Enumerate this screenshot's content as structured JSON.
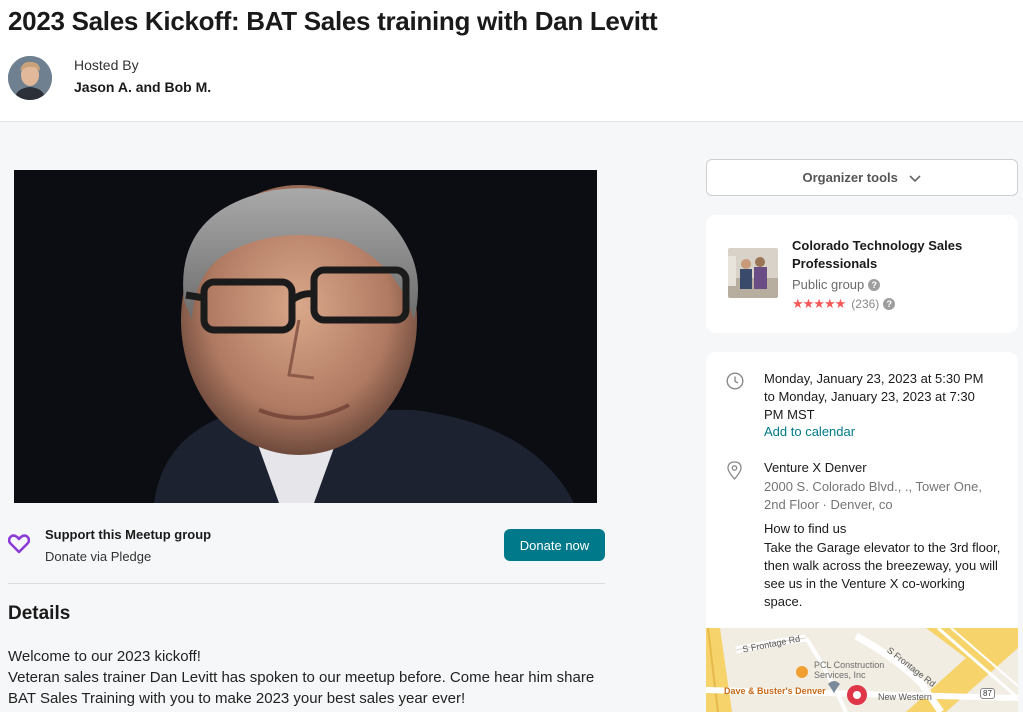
{
  "event": {
    "title": "2023 Sales Kickoff: BAT Sales training with Dan Levitt",
    "hosted_by_label": "Hosted By",
    "hosts": "Jason A. and Bob M."
  },
  "support": {
    "title": "Support this Meetup group",
    "subtitle": "Donate via Pledge",
    "button": "Donate now",
    "icon": "heart-icon",
    "accent_color": "#00798a"
  },
  "details": {
    "heading": "Details",
    "lines": [
      "Welcome to our 2023 kickoff!",
      "Veteran sales trainer Dan Levitt has spoken to our meetup before. Come hear him share BAT Sales Training with you to make 2023 your best sales year ever!"
    ]
  },
  "sidebar": {
    "organizer_tools": "Organizer tools",
    "group": {
      "name": "Colorado Technology Sales Professionals",
      "type": "Public group",
      "stars": "★★★★★",
      "rating_count": "(236)",
      "star_color": "#f65858"
    },
    "date": {
      "text": "Monday, January 23, 2023 at 5:30 PM to Monday, January 23, 2023 at 7:30 PM MST",
      "add_to_calendar": "Add to calendar"
    },
    "venue": {
      "name": "Venture X Denver",
      "address": "2000 S. Colorado Blvd., ., Tower One, 2nd Floor · Denver, co",
      "find_heading": "How to find us",
      "find_text": "Take the Garage elevator to the 3rd floor, then walk across the breezeway, you will see us in the Venture X co-working space."
    },
    "map": {
      "labels": {
        "road1": "S Frontage Rd",
        "road2": "S Frontage Rd",
        "poi1": "PCL Construction Services, Inc",
        "poi2": "Dave & Buster's Denver",
        "poi3": "New Western",
        "shield": "87"
      }
    }
  },
  "help_glyph": "?"
}
